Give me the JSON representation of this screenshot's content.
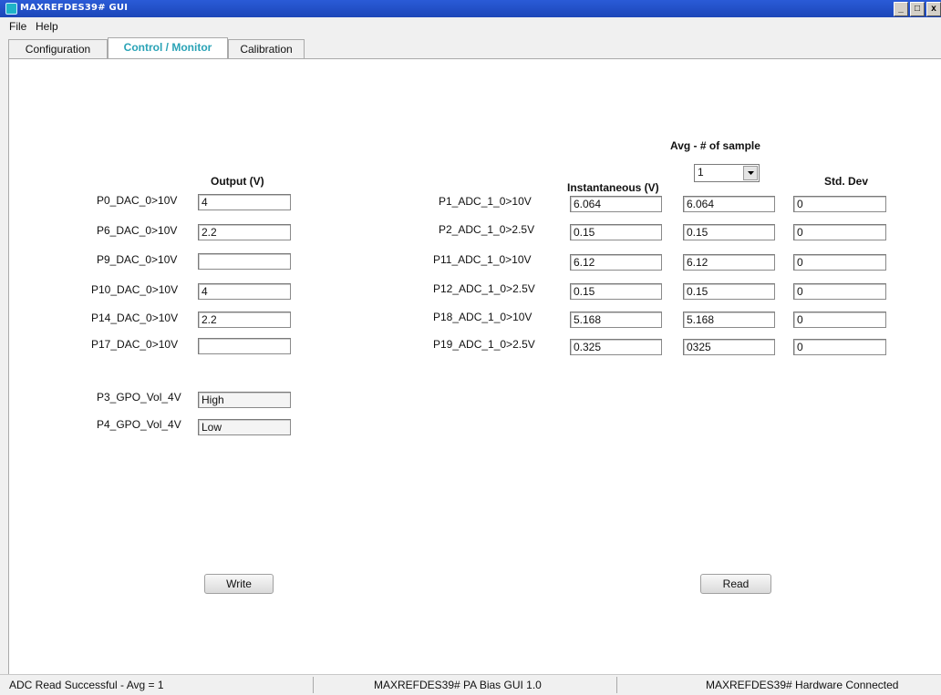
{
  "window": {
    "title": "MAXREFDES39# GUI",
    "controls": [
      "_",
      "□",
      "x"
    ]
  },
  "menu": [
    "File",
    "Help"
  ],
  "tabs": [
    "Configuration",
    "Control / Monitor",
    "Calibration"
  ],
  "active_tab": "Control / Monitor",
  "dac": {
    "header": "Output (V)",
    "rows": [
      {
        "label": "P0_DAC_0>10V",
        "value": "4"
      },
      {
        "label": "P6_DAC_0>10V",
        "value": "2.2"
      },
      {
        "label": "P9_DAC_0>10V",
        "value": ""
      },
      {
        "label": "P10_DAC_0>10V",
        "value": "4"
      },
      {
        "label": "P14_DAC_0>10V",
        "value": "2.2"
      },
      {
        "label": "P17_DAC_0>10V",
        "value": ""
      }
    ]
  },
  "gpo": [
    {
      "label": "P3_GPO_Vol_4V",
      "value": "High"
    },
    {
      "label": "P4_GPO_Vol_4V",
      "value": "Low"
    }
  ],
  "adc": {
    "avg_header": "Avg - # of sample",
    "avg_select": "1",
    "inst_header": "Instantaneous (V)",
    "std_header": "Std. Dev",
    "rows": [
      {
        "label": "P1_ADC_1_0>10V",
        "inst": "6.064",
        "avg": "6.064",
        "std": "0"
      },
      {
        "label": "P2_ADC_1_0>2.5V",
        "inst": "0.15",
        "avg": "0.15",
        "std": "0"
      },
      {
        "label": "P11_ADC_1_0>10V",
        "inst": "6.12",
        "avg": "6.12",
        "std": "0"
      },
      {
        "label": "P12_ADC_1_0>2.5V",
        "inst": "0.15",
        "avg": "0.15",
        "std": "0"
      },
      {
        "label": "P18_ADC_1_0>10V",
        "inst": "5.168",
        "avg": "5.168",
        "std": "0"
      },
      {
        "label": "P19_ADC_1_0>2.5V",
        "inst": "0.325",
        "avg": "0325",
        "std": "0"
      }
    ]
  },
  "buttons": {
    "write": "Write",
    "read": "Read"
  },
  "status": {
    "left": "ADC Read Successful - Avg = 1",
    "center": "MAXREFDES39# PA Bias GUI 1.0",
    "right": "MAXREFDES39# Hardware Connected"
  },
  "icons": {
    "app": "app-icon",
    "dropdown": "chevron-down-icon"
  },
  "colors": {
    "titlebar": "#1c46b8",
    "active_tab_text": "#2aa3b6"
  }
}
